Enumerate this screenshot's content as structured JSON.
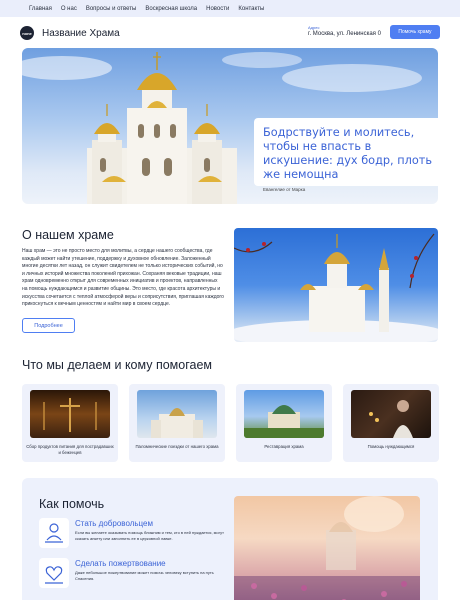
{
  "nav": {
    "items": [
      "Главная",
      "О нас",
      "Вопросы и ответы",
      "Воскресная школа",
      "Новости",
      "Контакты"
    ]
  },
  "header": {
    "logo_text": "none",
    "site_name": "Название Храма",
    "address_label": "Адрес",
    "address": "г. Москва, ул. Ленинская 0",
    "help_button": "Помочь храму"
  },
  "hero": {
    "quote": "Бодрствуйте и молитесь, чтобы не впасть в искушение: дух бодр, плоть же немощна",
    "source": "Евангелие от Марка"
  },
  "about": {
    "title": "О нашем храме",
    "text": "Наш храм — это не просто место для молитвы, а сердце нашего сообщества, где каждый может найти утешение, поддержку и духовное обновление. Заложенный многие десятки лет назад, он служит свидетелем не только исторических событий, но и личных историй множества поколений прихожан. Сохраняя вековые традиции, наш храм одновременно открыт для современных инициатив и проектов, направленных на помощь нуждающимся и развитие общины. Это место, где красота архитектуры и искусства сочетается с теплой атмосферой веры и соприсутствия, приглашая каждого прикоснуться к вечным ценностям и найти мир в своем сердце.",
    "more_button": "Подробнее"
  },
  "services": {
    "title": "Что мы делаем и кому помогаем",
    "cards": [
      {
        "caption": "Сбор продуктов питания для пострадавших и беженцев"
      },
      {
        "caption": "Паломнические поездки от нашего храма"
      },
      {
        "caption": "Реставрация храма"
      },
      {
        "caption": "Помощь нуждающимся"
      }
    ]
  },
  "help": {
    "title": "Как помочь",
    "items": [
      {
        "title": "Стать добровольцем",
        "text": "Если вы желаете оказывать помощь ближним и тем, кто в ней нуждается, могут сказать анкету или заполнить ее в церковной лавке.",
        "icon": "volunteer-icon"
      },
      {
        "title": "Сделать пожертвование",
        "text": "Даже небольшое пожертвование может помочь человеку вступить на путь Спасения.",
        "icon": "donation-icon"
      }
    ]
  },
  "colors": {
    "accent": "#4f7ef2",
    "accent_text": "#3b63d6",
    "nav_bg": "#eaeefb",
    "card_bg": "#eef1fb"
  }
}
